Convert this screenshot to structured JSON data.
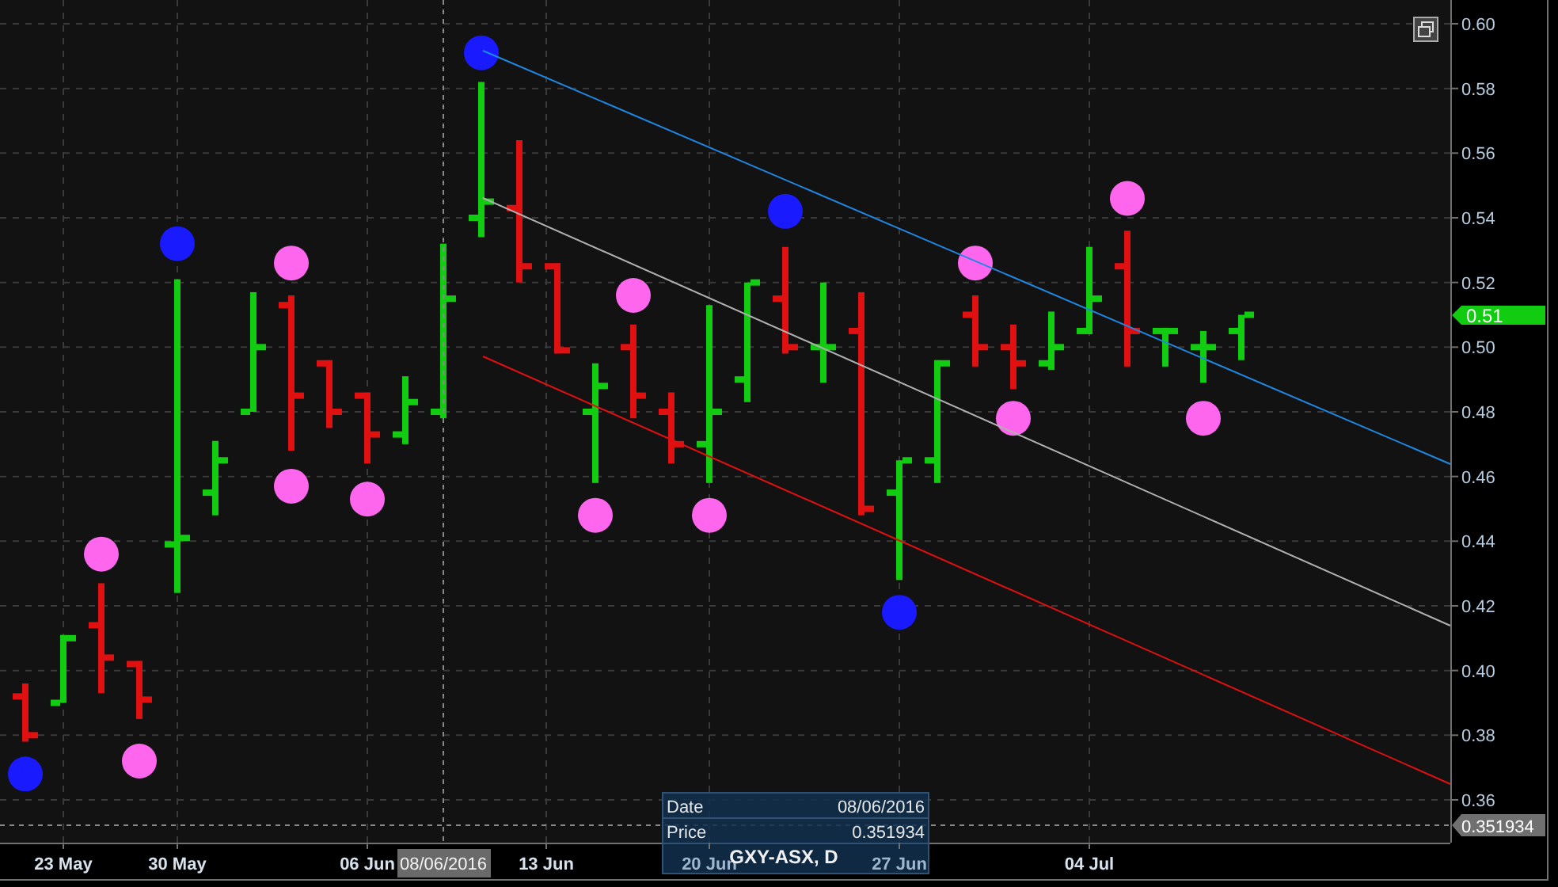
{
  "chart": {
    "price_axis": [
      "0.60",
      "0.58",
      "0.56",
      "0.54",
      "0.52",
      "0.50",
      "0.48",
      "0.46",
      "0.44",
      "0.42",
      "0.40",
      "0.38",
      "0.36"
    ],
    "last_price": "0.51",
    "crosshair_price": "0.351934",
    "date_axis": [
      {
        "label": "23 May",
        "selected": false
      },
      {
        "label": "30 May",
        "selected": false
      },
      {
        "label": "06 Jun",
        "selected": false
      },
      {
        "label": "08/06/2016",
        "selected": true
      },
      {
        "label": "13 Jun",
        "selected": false
      },
      {
        "label": "20 Jun",
        "selected": false
      },
      {
        "label": "27 Jun",
        "selected": false
      },
      {
        "label": "04 Jul",
        "selected": false
      }
    ],
    "tooltip": {
      "rows": [
        {
          "label": "Date",
          "value": "08/06/2016"
        },
        {
          "label": "Price",
          "value": "0.351934"
        }
      ],
      "symbol": "GXY-ASX, D"
    }
  }
}
